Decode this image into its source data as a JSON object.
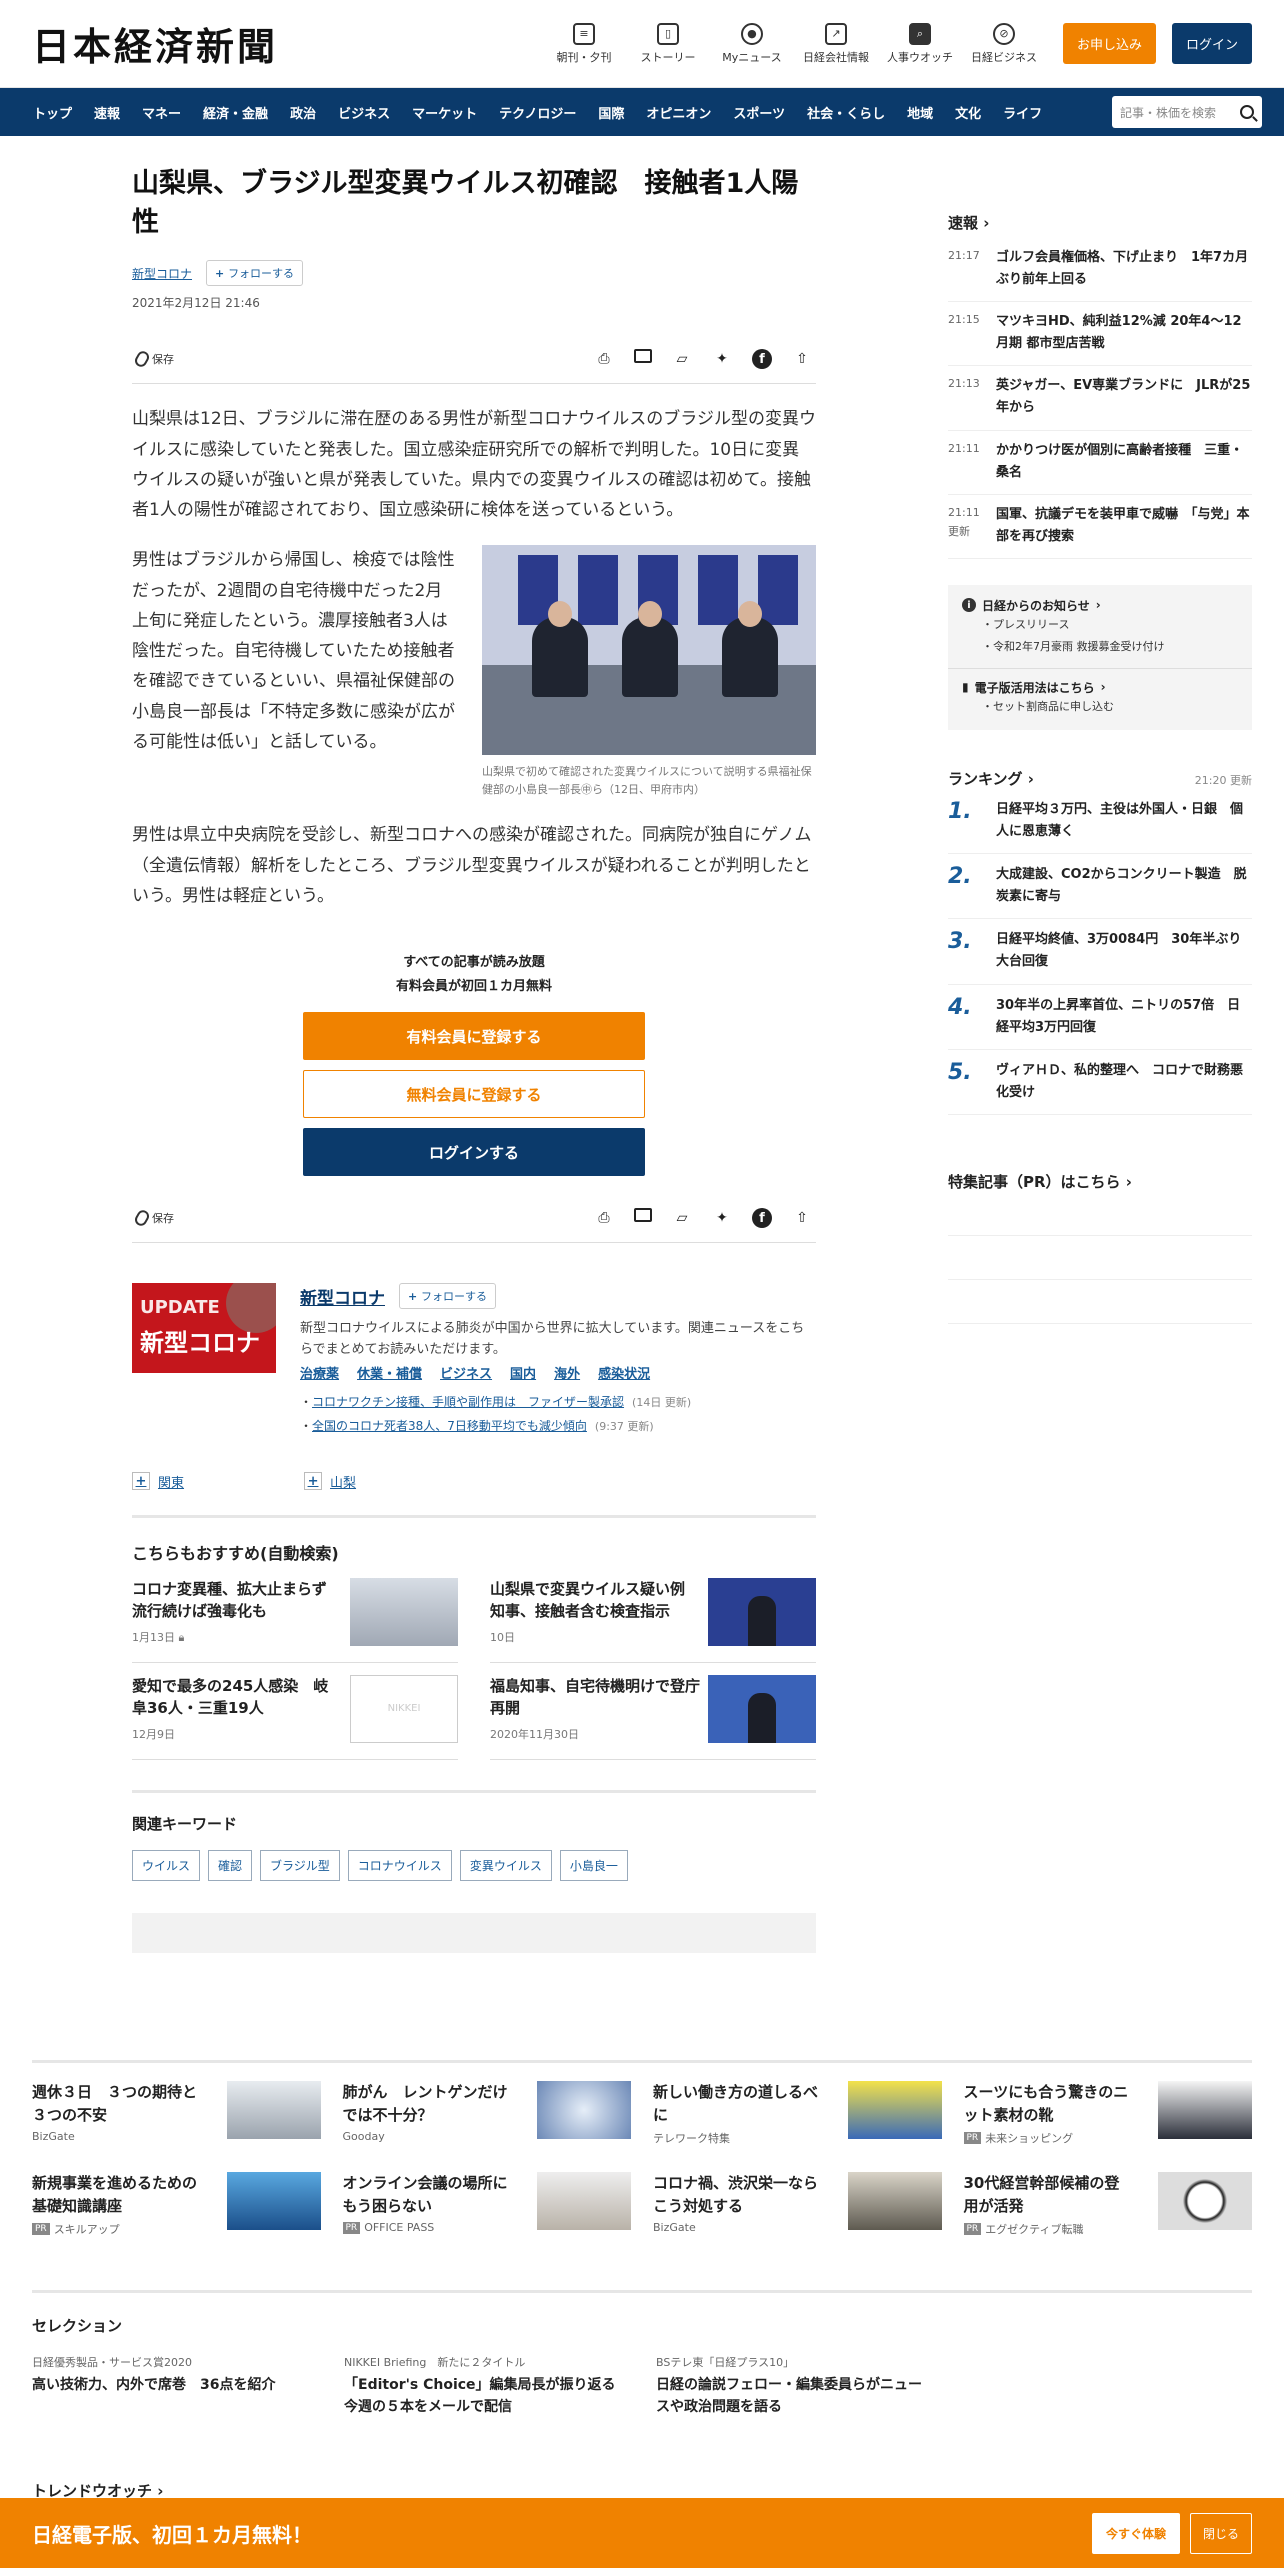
{
  "header": {
    "logo": "日本経済新聞",
    "icons": [
      {
        "label": "朝刊・夕刊",
        "icon": "newspaper-icon"
      },
      {
        "label": "ストーリー",
        "icon": "story-icon"
      },
      {
        "label": "Myニュース",
        "icon": "user-icon"
      },
      {
        "label": "日経会社情報",
        "icon": "chart-icon"
      },
      {
        "label": "人事ウオッチ",
        "icon": "search-person-icon"
      },
      {
        "label": "日経ビジネス",
        "icon": "compass-icon"
      }
    ],
    "apply_label": "お申し込み",
    "login_label": "ログイン"
  },
  "nav": {
    "items": [
      "トップ",
      "速報",
      "マネー",
      "経済・金融",
      "政治",
      "ビジネス",
      "マーケット",
      "テクノロジー",
      "国際",
      "オピニオン",
      "スポーツ",
      "社会・くらし",
      "地域",
      "文化",
      "ライフ"
    ],
    "search_placeholder": "記事・株価を検索"
  },
  "article": {
    "title": "山梨県、ブラジル型変異ウイルス初確認　接触者1人陽性",
    "topic": "新型コロナ",
    "follow_label": "フォローする",
    "date": "2021年2月12日 21:46",
    "save_label": "保存",
    "p1": "山梨県は12日、ブラジルに滞在歴のある男性が新型コロナウイルスのブラジル型の変異ウイルスに感染していたと発表した。国立感染症研究所での解析で判明した。10日に変異ウイルスの疑いが強いと県が発表していた。県内での変異ウイルスの確認は初めて。接触者1人の陽性が確認されており、国立感染研に検体を送っているという。",
    "p2": "男性はブラジルから帰国し、検疫では陰性だったが、2週間の自宅待機中だった2月上旬に発症したという。濃厚接触者3人は陰性だった。自宅待機していたため接触者を確認できているといい、県福祉保健部の小島良一部長は「不特定多数に感染が広がる可能性は低い」と話している。",
    "caption": "山梨県で初めて確認された変異ウイルスについて説明する県福祉保健部の小島良一部長㊥ら（12日、甲府市内）",
    "p3": "男性は県立中央病院を受診し、新型コロナへの感染が確認された。同病院が独自にゲノム（全遺伝情報）解析をしたところ、ブラジル型変異ウイルスが疑われることが判明したという。男性は軽症という。"
  },
  "paywall": {
    "line1": "すべての記事が読み放題",
    "line2": "有料会員が初回１カ月無料",
    "paid_label": "有料会員に登録する",
    "free_label": "無料会員に登録する",
    "login_label": "ログインする"
  },
  "topic_box": {
    "image_upd": "UPDATE",
    "image_name": "新型コロナ",
    "name": "新型コロナ",
    "follow_label": "フォローする",
    "desc": "新型コロナウイルスによる肺炎が中国から世界に拡大しています。関連ニュースをこちらでまとめてお読みいただけます。",
    "tags": [
      "治療薬",
      "休業・補償",
      "ビジネス",
      "国内",
      "海外",
      "感染状況"
    ],
    "news": [
      {
        "title": "コロナワクチン接種、手順や副作用は　ファイザー製承認",
        "ago": "(14日 更新)"
      },
      {
        "title": "全国のコロナ死者38人、7日移動平均でも減少傾向",
        "ago": "(9:37 更新)"
      }
    ]
  },
  "regions": [
    "関東",
    "山梨"
  ],
  "recommend": {
    "title": "こちらもおすすめ(自動検索)",
    "items": [
      {
        "title": "コロナ変異種、拡大止まらず　流行続けば強毒化も",
        "date": "1月13日"
      },
      {
        "title": "山梨県で変異ウイルス疑い例　知事、接触者含む検査指示",
        "date": "10日"
      },
      {
        "title": "愛知で最多の245人感染　岐阜36人・三重19人",
        "date": "12月9日",
        "thumb_text": "NIKKEI"
      },
      {
        "title": "福島知事、自宅待機明けで登庁再開",
        "date": "2020年11月30日"
      }
    ]
  },
  "keywords": {
    "title": "関連キーワード",
    "items": [
      "ウイルス",
      "確認",
      "ブラジル型",
      "コロナウイルス",
      "変異ウイルス",
      "小島良一"
    ]
  },
  "sidebar": {
    "flash_title": "速報",
    "flash": [
      {
        "time": "21:17",
        "text": "ゴルフ会員権価格、下げ止まり　1年7カ月ぶり前年上回る"
      },
      {
        "time": "21:15",
        "text": "マツキヨHD、純利益12%減 20年4～12月期 都市型店苦戦"
      },
      {
        "time": "21:13",
        "text": "英ジャガー、EV専業ブランドに　JLRが25年から"
      },
      {
        "time": "21:11",
        "text": "かかりつけ医が個別に高齢者接種　三重・桑名"
      },
      {
        "time": "21:11",
        "upd": "更新",
        "text": "国軍、抗議デモを装甲車で威嚇　「与党」本部を再び捜索"
      }
    ],
    "notice_title": "日経からのお知らせ",
    "notice_items": [
      "プレスリリース",
      "令和2年7月豪雨 救援募金受け付け"
    ],
    "ebook_title": "電子版活用法はこちら",
    "ebook_items": [
      "セット割商品に申し込む"
    ],
    "ranking_title": "ランキング",
    "ranking_time": "21:20 更新",
    "ranking": [
      {
        "no": "1.",
        "text": "日経平均３万円、主役は外国人・日銀　個人に恩恵薄く"
      },
      {
        "no": "2.",
        "text": "大成建設、CO2からコンクリート製造　脱炭素に寄与"
      },
      {
        "no": "3.",
        "text": "日経平均終値、3万0084円　30年半ぶり大台回復"
      },
      {
        "no": "4.",
        "text": "30年半の上昇率首位、ニトリの57倍　日経平均3万円回復"
      },
      {
        "no": "5.",
        "text": "ヴィアＨＤ、私的整理へ　コロナで財務悪化受け"
      }
    ],
    "pr_title": "特集記事（PR）はこちら"
  },
  "ads": [
    {
      "title": "週休３日　３つの期待と３つの不安",
      "src": "BizGate",
      "pr": false
    },
    {
      "title": "肺がん　レントゲンだけでは不十分？",
      "src": "Gooday",
      "pr": false
    },
    {
      "title": "新しい働き方の道しるべに",
      "src": "テレワーク特集",
      "pr": false
    },
    {
      "title": "スーツにも合う驚きのニット素材の靴",
      "src": "未来ショッピング",
      "pr": true
    },
    {
      "title": "新規事業を進めるための基礎知識講座",
      "src": "スキルアップ",
      "pr": true
    },
    {
      "title": "オンライン会議の場所にもう困らない",
      "src": "OFFICE PASS",
      "pr": true
    },
    {
      "title": "コロナ禍、渋沢栄一ならこう対処する",
      "src": "BizGate",
      "pr": false
    },
    {
      "title": "30代経営幹部候補の登用が活発",
      "src": "エグゼクティブ転職",
      "pr": true
    }
  ],
  "pr_badge": "PR",
  "selection": {
    "title": "セレクション",
    "items": [
      {
        "cat": "日経優秀製品・サービス賞2020",
        "title": "高い技術力、内外で席巻　36点を紹介"
      },
      {
        "cat": "NIKKEI Briefing　新たに２タイトル",
        "title": "「Editor's Choice」編集局長が振り返る今週の５本をメールで配信"
      },
      {
        "cat": "BSテレ東「日経プラス10」",
        "title": "日経の論説フェロー・編集委員らがニュースや政治問題を語る"
      }
    ]
  },
  "trend_title": "トレンドウオッチ",
  "bottom_banner": {
    "text": "日経電子版、初回１カ月無料！",
    "try_label": "今すぐ体験",
    "close_label": "閉じる"
  }
}
